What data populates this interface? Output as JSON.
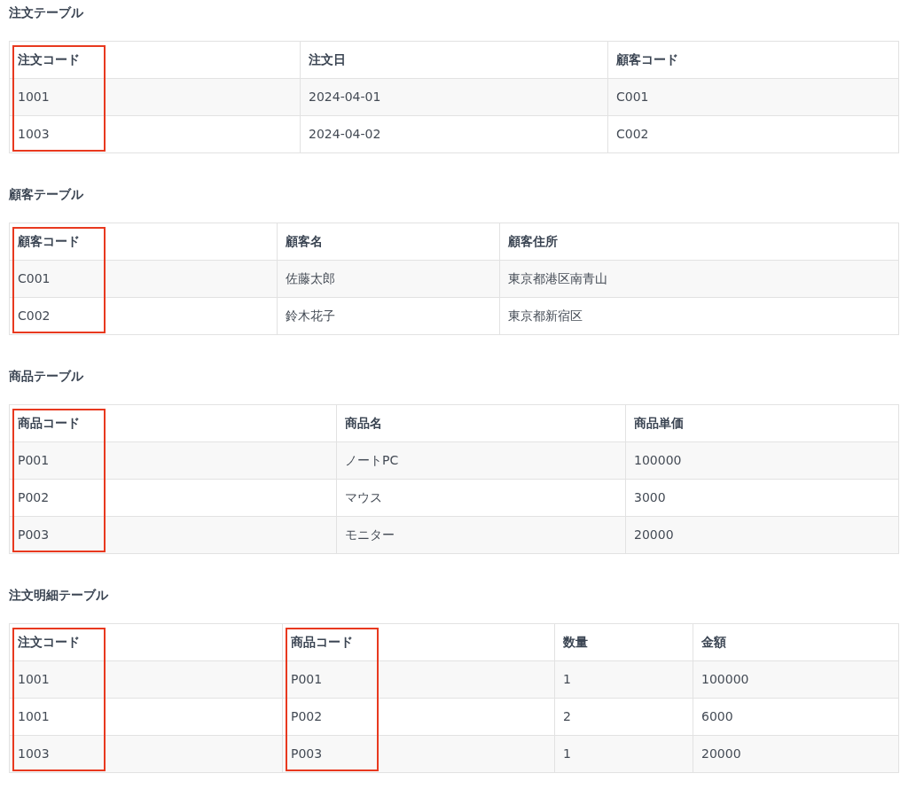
{
  "sections": [
    {
      "title": "注文テーブル",
      "columns": [
        {
          "label": "注文コード",
          "highlighted": true
        },
        {
          "label": "注文日",
          "highlighted": false
        },
        {
          "label": "顧客コード",
          "highlighted": false
        }
      ],
      "rows": [
        [
          "1001",
          "2024-04-01",
          "C001"
        ],
        [
          "1003",
          "2024-04-02",
          "C002"
        ]
      ]
    },
    {
      "title": "顧客テーブル",
      "columns": [
        {
          "label": "顧客コード",
          "highlighted": true
        },
        {
          "label": "顧客名",
          "highlighted": false
        },
        {
          "label": "顧客住所",
          "highlighted": false
        }
      ],
      "rows": [
        [
          "C001",
          "佐藤太郎",
          "東京都港区南青山"
        ],
        [
          "C002",
          "鈴木花子",
          "東京都新宿区"
        ]
      ]
    },
    {
      "title": "商品テーブル",
      "columns": [
        {
          "label": "商品コード",
          "highlighted": true
        },
        {
          "label": "商品名",
          "highlighted": false
        },
        {
          "label": "商品単価",
          "highlighted": false
        }
      ],
      "rows": [
        [
          "P001",
          "ノートPC",
          "100000"
        ],
        [
          "P002",
          "マウス",
          "3000"
        ],
        [
          "P003",
          "モニター",
          "20000"
        ]
      ]
    },
    {
      "title": "注文明細テーブル",
      "columns": [
        {
          "label": "注文コード",
          "highlighted": true
        },
        {
          "label": "商品コード",
          "highlighted": true
        },
        {
          "label": "数量",
          "highlighted": false
        },
        {
          "label": "金額",
          "highlighted": false
        }
      ],
      "rows": [
        [
          "1001",
          "P001",
          "1",
          "100000"
        ],
        [
          "1001",
          "P002",
          "2",
          "6000"
        ],
        [
          "1003",
          "P003",
          "1",
          "20000"
        ]
      ]
    }
  ]
}
